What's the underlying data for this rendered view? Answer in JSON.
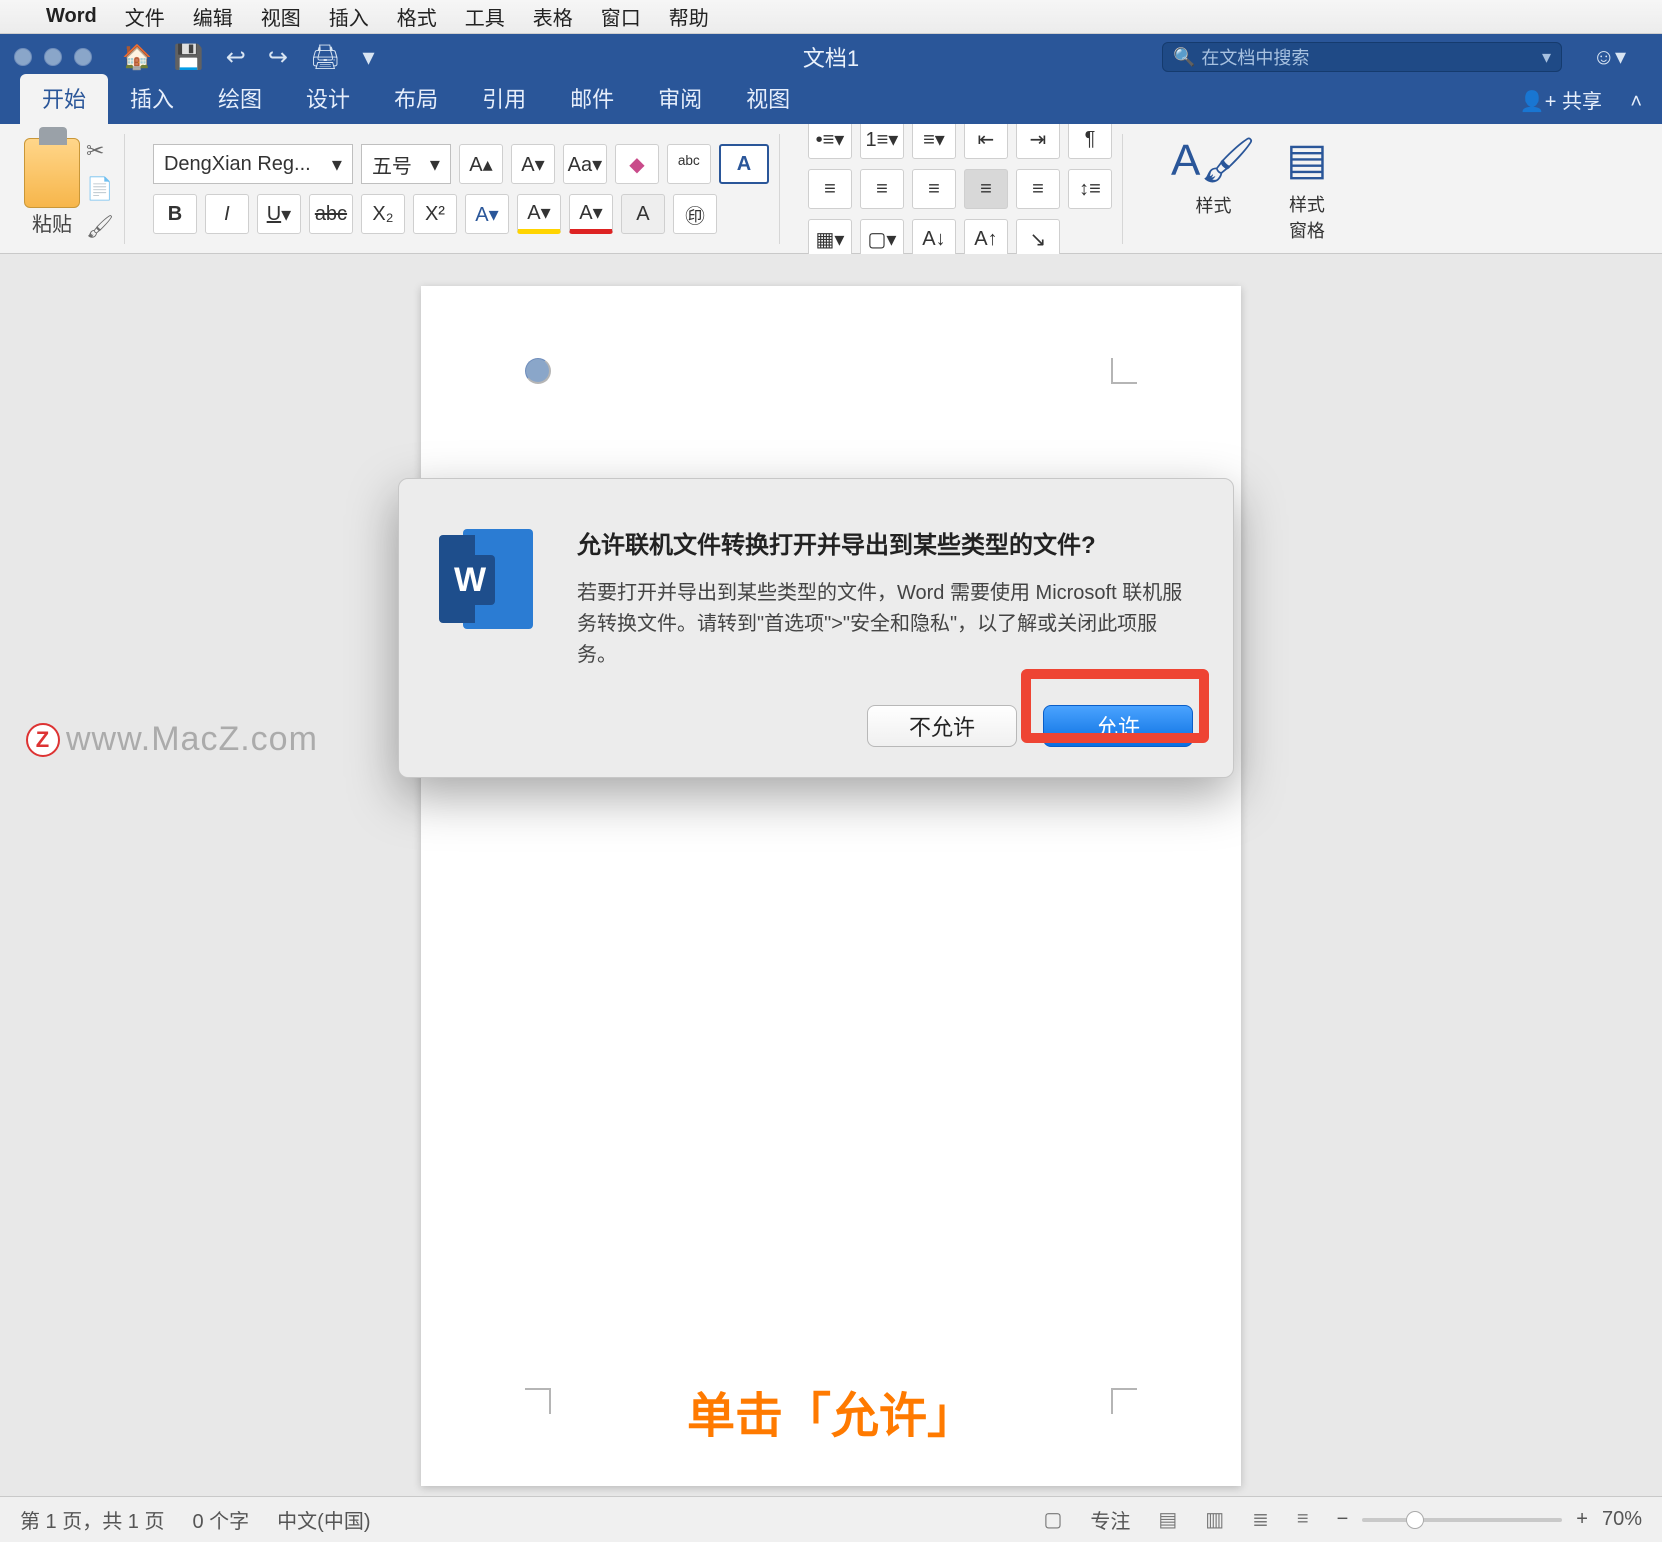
{
  "mac_menu": {
    "app": "Word",
    "items": [
      "文件",
      "编辑",
      "视图",
      "插入",
      "格式",
      "工具",
      "表格",
      "窗口",
      "帮助"
    ]
  },
  "titlebar": {
    "doc_title": "文档1",
    "search_placeholder": "在文档中搜索"
  },
  "tabs": {
    "items": [
      "开始",
      "插入",
      "绘图",
      "设计",
      "布局",
      "引用",
      "邮件",
      "审阅",
      "视图"
    ],
    "active_index": 0,
    "share": "共享"
  },
  "ribbon": {
    "paste_label": "粘贴",
    "font_name": "DengXian Reg...",
    "font_size": "五号",
    "styles_label": "样式",
    "styles_pane_label": "样式\n窗格"
  },
  "dialog": {
    "heading": "允许联机文件转换打开并导出到某些类型的文件?",
    "body": "若要打开并导出到某些类型的文件，Word 需要使用 Microsoft 联机服务转换文件。请转到\"首选项\">\"安全和隐私\"，以了解或关闭此项服务。",
    "deny": "不允许",
    "allow": "允许"
  },
  "watermark": "www.MacZ.com",
  "annotation": "单击「允许」",
  "statusbar": {
    "page": "第 1 页，共 1 页",
    "words": "0 个字",
    "language": "中文(中国)",
    "focus": "专注",
    "zoom_percent": "70%"
  }
}
